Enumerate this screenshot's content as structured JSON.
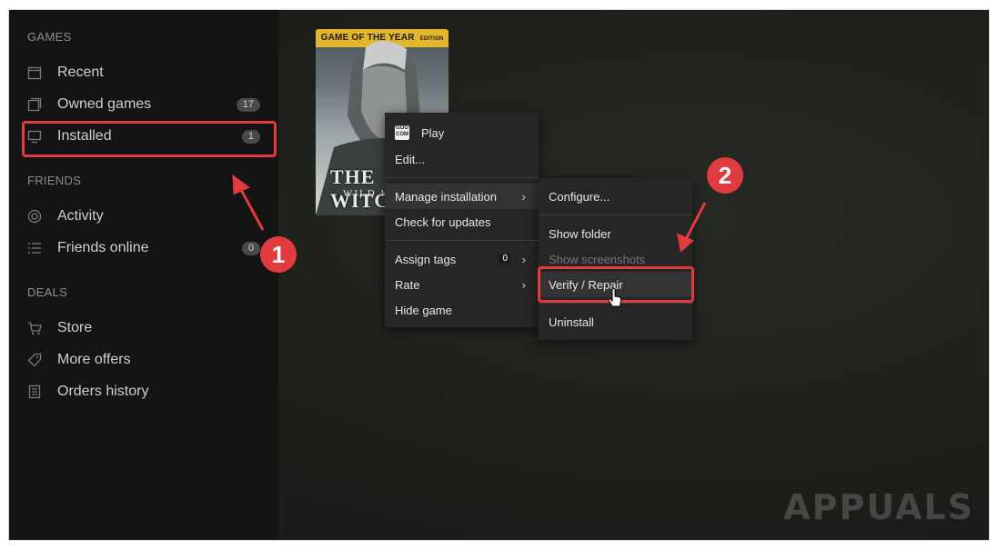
{
  "sidebar": {
    "sections": [
      {
        "title": "GAMES",
        "items": [
          {
            "label": "Recent",
            "icon": "calendar-icon",
            "count": ""
          },
          {
            "label": "Owned games",
            "icon": "library-icon",
            "count": "17"
          },
          {
            "label": "Installed",
            "icon": "monitor-icon",
            "count": "1"
          }
        ]
      },
      {
        "title": "FRIENDS",
        "items": [
          {
            "label": "Activity",
            "icon": "activity-icon",
            "count": ""
          },
          {
            "label": "Friends online",
            "icon": "list-icon",
            "count": "0"
          }
        ]
      },
      {
        "title": "DEALS",
        "items": [
          {
            "label": "Store",
            "icon": "cart-icon",
            "count": ""
          },
          {
            "label": "More offers",
            "icon": "tag-icon",
            "count": ""
          },
          {
            "label": "Orders history",
            "icon": "receipt-icon",
            "count": ""
          }
        ]
      }
    ]
  },
  "game_cover": {
    "banner": "GAME OF THE YEAR",
    "banner_sub": "EDITION",
    "title": "THE WITCHER",
    "subtitle": "WILD HUNT"
  },
  "context_menu": {
    "gog_icon_text": "GOG COM",
    "items": [
      {
        "label": "Play"
      },
      {
        "label": "Edit..."
      },
      {
        "label": "Manage installation"
      },
      {
        "label": "Check for updates"
      },
      {
        "label": "Assign tags",
        "count": "0"
      },
      {
        "label": "Rate"
      },
      {
        "label": "Hide game"
      }
    ]
  },
  "submenu": {
    "items": [
      {
        "label": "Configure..."
      },
      {
        "label": "Show folder"
      },
      {
        "label": "Show screenshots",
        "disabled": true
      },
      {
        "label": "Verify / Repair"
      },
      {
        "label": "Uninstall"
      }
    ]
  },
  "annotations": {
    "step1": "1",
    "step2": "2",
    "color": "#e23b3f"
  },
  "watermark": "APPUALS"
}
